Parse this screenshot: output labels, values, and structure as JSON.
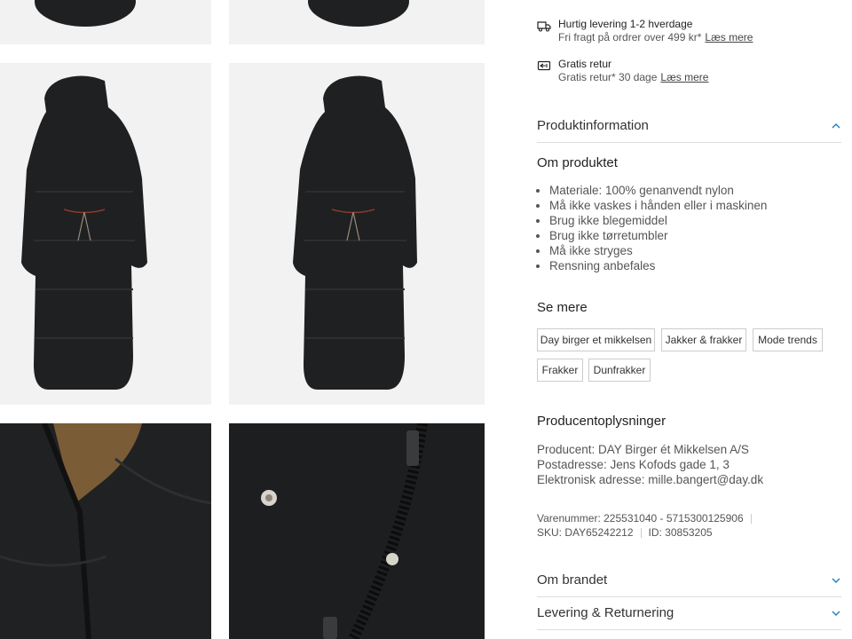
{
  "shipping": {
    "fast_title": "Hurtig levering 1-2 hverdage",
    "fast_sub": "Fri fragt på ordrer over 499 kr*",
    "fast_link": "Læs mere",
    "return_title": "Gratis retur",
    "return_sub": "Gratis retur* 30 dage",
    "return_link": "Læs mere"
  },
  "product_info": {
    "heading": "Produktinformation",
    "about_title": "Om produktet",
    "features": [
      "Materiale: 100% genanvendt nylon",
      "Må ikke vaskes i hånden eller i maskinen",
      "Brug ikke blegemiddel",
      "Brug ikke tørretumbler",
      "Må ikke stryges",
      "Rensning anbefales"
    ]
  },
  "see_more": {
    "title": "Se mere",
    "tags": [
      "Day birger et mikkelsen",
      "Jakker & frakker",
      "Mode trends",
      "Frakker",
      "Dunfrakker"
    ]
  },
  "producer": {
    "title": "Producentoplysninger",
    "name": "Producent: DAY Birger ét Mikkelsen A/S",
    "address": "Postadresse: Jens Kofods gade 1, 3",
    "email": "Elektronisk adresse: mille.bangert@day.dk"
  },
  "meta": {
    "item_number": "Varenummer: 225531040 - 5715300125906",
    "sku": "SKU: DAY65242212",
    "id": "ID: 30853205"
  },
  "accordions": {
    "brand": "Om brandet",
    "delivery": "Levering & Returnering"
  },
  "colors": {
    "coat": "#1f2021",
    "tile_bg": "#f2f2f2",
    "chevron": "#1a7fc1"
  }
}
